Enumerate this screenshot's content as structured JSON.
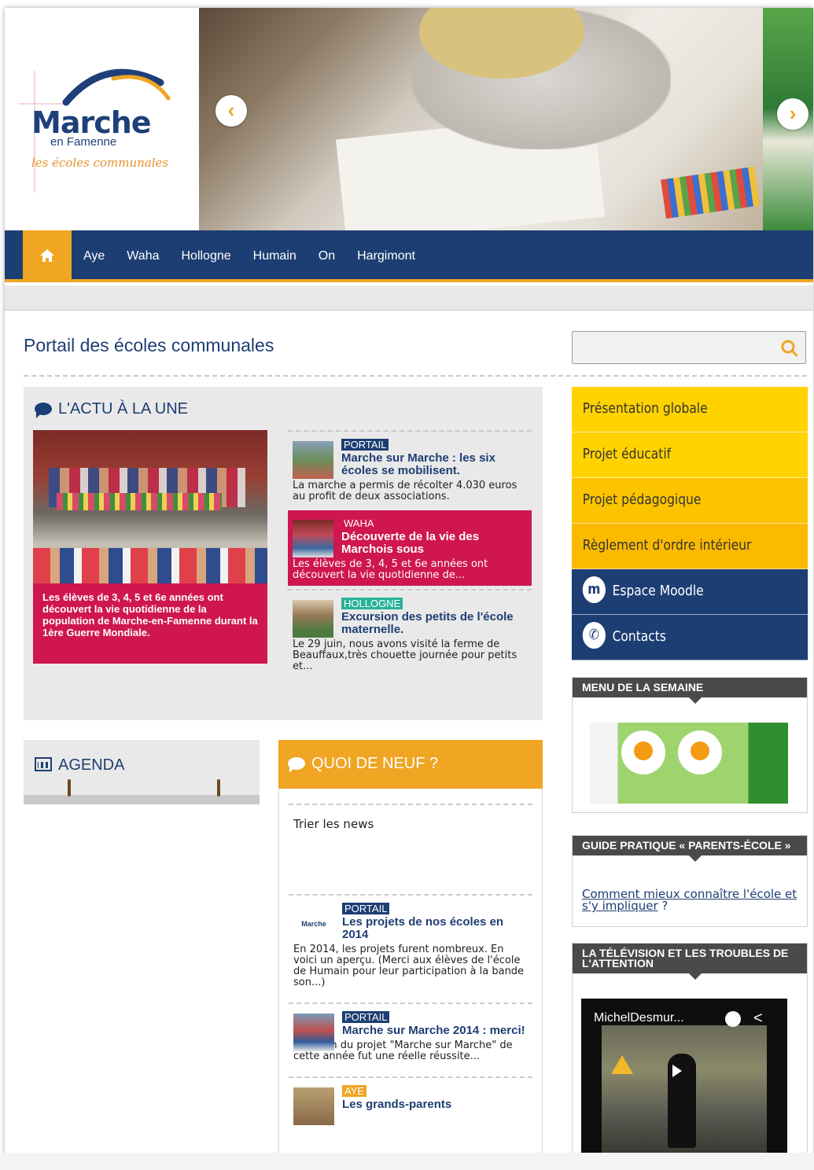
{
  "header": {
    "logo_main": "Marche",
    "logo_sub": "en Famenne",
    "logo_tagline": "les écoles communales",
    "prev_arrow": "‹",
    "next_arrow": "›"
  },
  "nav": {
    "items": [
      "Aye",
      "Waha",
      "Hollogne",
      "Humain",
      "On",
      "Hargimont"
    ]
  },
  "page_title": "Portail des écoles communales",
  "search": {
    "placeholder": ""
  },
  "actu": {
    "title": "L'ACTU À LA UNE",
    "feature_caption": "Les élèves de 3, 4, 5 et 6e années ont découvert la vie quotidienne de la population de Marche-en-Famenne durant la 1ère Guerre Mondiale.",
    "news": [
      {
        "tag": "PORTAIL",
        "headline": "Marche sur Marche : les six écoles se mobilisent.",
        "excerpt": "La marche a permis de récolter 4.030 euros au profit de deux associations."
      },
      {
        "tag": "WAHA",
        "headline": "Découverte de la vie des Marchois sous",
        "excerpt": "Les élèves de 3, 4, 5 et 6e années ont découvert la vie quotidienne de..."
      },
      {
        "tag": "HOLLOGNE",
        "headline": "Excursion des petits de l'école maternelle.",
        "excerpt": "Le 29 juin, nous avons visité la ferme de Beauffaux,très chouette journée pour petits et..."
      }
    ]
  },
  "agenda": {
    "title": "AGENDA"
  },
  "quoi": {
    "title": "QUOI DE NEUF ?",
    "trier": "Trier les news",
    "news": [
      {
        "tag": "PORTAIL",
        "thumb_text": "Marche",
        "headline": "Les projets de nos écoles en 2014",
        "excerpt": "En 2014, les projets furent nombreux. En voici un aperçu. (Merci aux élèves de l'école de Humain pour leur participation à la bande son...)"
      },
      {
        "tag": "PORTAIL",
        "headline": "Marche sur Marche 2014 : merci!",
        "excerpt": "L'édition du projet \"Marche sur Marche\" de cette année fut une réelle réussite..."
      },
      {
        "tag": "AYE",
        "headline": "Les grands-parents"
      }
    ]
  },
  "side_menu": {
    "items": [
      "Présentation globale",
      "Projet éducatif",
      "Projet pédagogique",
      "Règlement d'ordre intérieur",
      "Espace Moodle",
      "Contacts"
    ],
    "moodle_icon_text": "m",
    "contacts_icon_text": "✆"
  },
  "menu_semaine": {
    "title": "MENU DE LA SEMAINE"
  },
  "guide": {
    "title": "GUIDE PRATIQUE « PARENTS-ÉCOLE »",
    "link_text": "Comment mieux connaître l'école et s'y impliquer",
    "link_suffix": " ?"
  },
  "tv": {
    "title": "LA TÉLÉVISION ET LES TROUBLES DE L'ATTENTION",
    "video_title": "MichelDesmur..."
  },
  "colors": {
    "navy": "#1d3e73",
    "orange": "#f0a523",
    "pink": "#cf1650",
    "teal": "#28b29a",
    "yellow": "#ffd200"
  },
  "icons": [
    "home-icon",
    "search-icon",
    "chat-bubble-icon",
    "calendar-icon",
    "moodle-icon",
    "phone-icon",
    "clock-icon",
    "share-icon",
    "play-icon",
    "warning-icon"
  ]
}
